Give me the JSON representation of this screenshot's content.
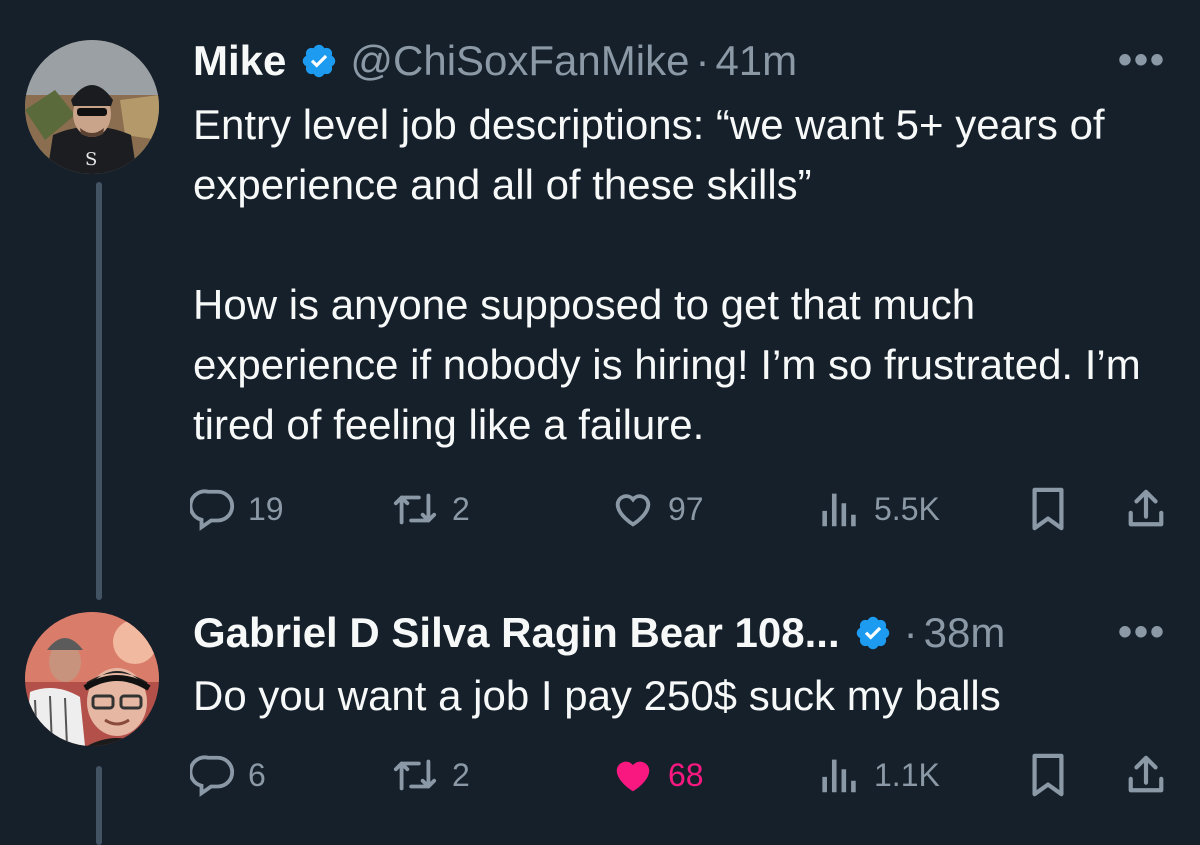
{
  "tweets": [
    {
      "name": "Mike",
      "handle": "@ChiSoxFanMike",
      "separator": "·",
      "time": "41m",
      "more": "•••",
      "paragraphs": [
        "Entry level job descriptions: “we want 5+ years of experience and all of these skills”",
        "How is anyone supposed to get that much experience if nobody is hiring! I’m so frustrated. I’m tired of feeling like a failure."
      ],
      "replies": "19",
      "retweets": "2",
      "likes": "97",
      "views": "5.5K",
      "liked": false
    },
    {
      "name": "Gabriel D Silva Ragin Bear 108...",
      "handle": "",
      "separator": "·",
      "time": "38m",
      "more": "•••",
      "paragraphs": [
        "Do you want a job I pay 250$ suck my balls"
      ],
      "replies": "6",
      "retweets": "2",
      "likes": "68",
      "views": "1.1K",
      "liked": true
    }
  ],
  "icons": {
    "verified": "verified-badge-icon",
    "reply": "reply-icon",
    "retweet": "retweet-icon",
    "like": "heart-icon",
    "views": "views-icon",
    "bookmark": "bookmark-icon",
    "share": "share-icon"
  },
  "colors": {
    "background": "#15202b",
    "text": "#f7f9f9",
    "muted": "#8b98a5",
    "verified": "#1d9bf0",
    "like_active": "#f91880",
    "thread_line": "#425364"
  }
}
